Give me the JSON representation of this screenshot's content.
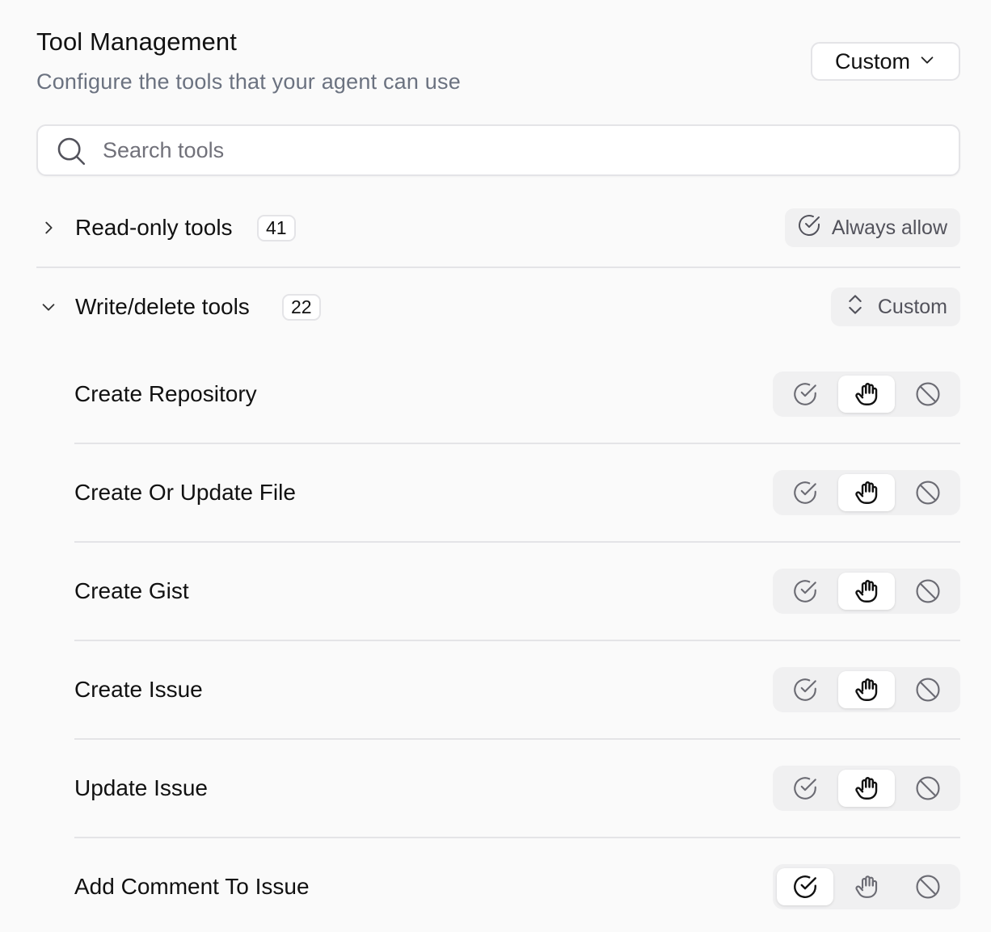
{
  "header": {
    "title": "Tool Management",
    "subtitle": "Configure the tools that your agent can use",
    "preset": "Custom"
  },
  "search": {
    "placeholder": "Search tools",
    "value": ""
  },
  "groups": [
    {
      "label": "Read-only tools",
      "count": "41",
      "expanded": false,
      "action_label": "Always allow",
      "action_icon": "check-circle-icon"
    },
    {
      "label": "Write/delete tools",
      "count": "22",
      "expanded": true,
      "action_label": "Custom",
      "action_icon": "chevron-up-down-icon"
    }
  ],
  "tools": [
    {
      "name": "Create Repository",
      "permission": "ask"
    },
    {
      "name": "Create Or Update File",
      "permission": "ask"
    },
    {
      "name": "Create Gist",
      "permission": "ask"
    },
    {
      "name": "Create Issue",
      "permission": "ask"
    },
    {
      "name": "Update Issue",
      "permission": "ask"
    },
    {
      "name": "Add Comment To Issue",
      "permission": "allow"
    }
  ],
  "permission_options": [
    {
      "key": "allow",
      "icon": "check-circle-icon"
    },
    {
      "key": "ask",
      "icon": "hand-icon"
    },
    {
      "key": "block",
      "icon": "ban-icon"
    }
  ],
  "colors": {
    "background": "#fafafa",
    "text_primary": "#111111",
    "text_muted": "#6b7280",
    "border": "#e4e4e7",
    "segment_bg": "#f0f0f1",
    "segment_active": "#ffffff"
  }
}
